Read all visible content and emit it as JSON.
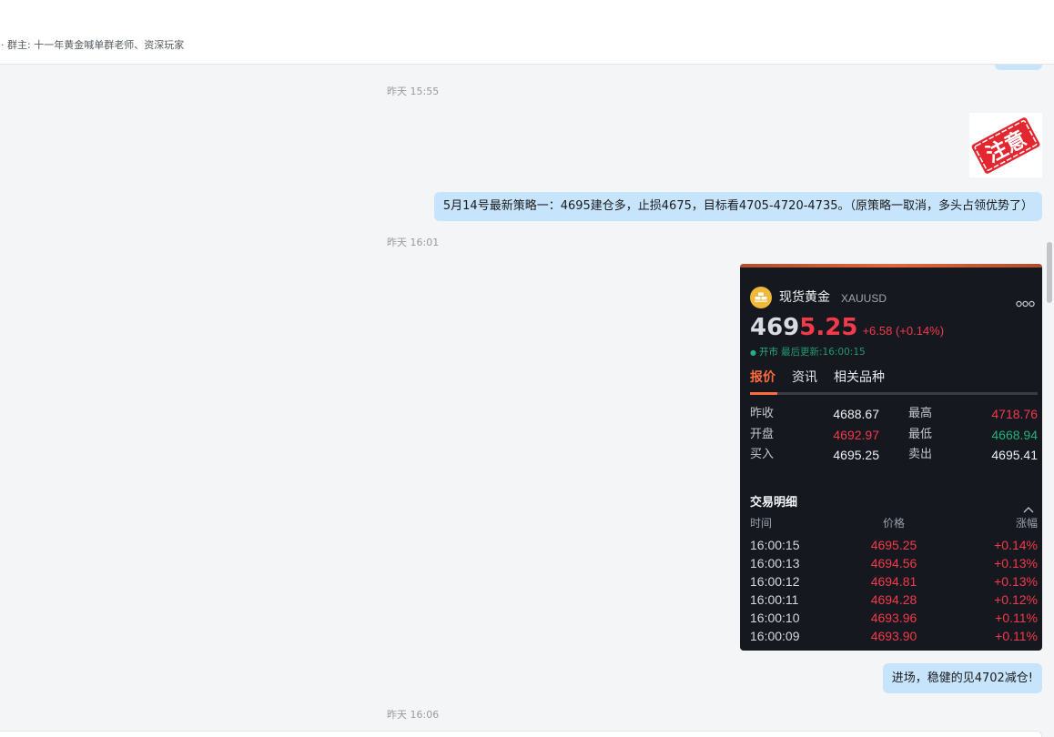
{
  "header": {
    "owner_line": "· 群主: 十一年黄金喊单群老师、资深玩家"
  },
  "timestamps": {
    "t1": "昨天 15:55",
    "t2": "昨天 16:01",
    "t3": "昨天 16:06"
  },
  "messages": {
    "stamp": {
      "icon": "warning-stamp-image",
      "text": "注意"
    },
    "strategy": "5月14号最新策略一：4695建仓多，止损4675，目标看4705-4720-4735。（原策略一取消，多头占领优势了）",
    "entry": "进场，稳健的见4702减仓!"
  },
  "quote_card": {
    "icon": "gold-bars-icon",
    "name": "现货黄金",
    "symbol": "XAUUSD",
    "more_icon": "more-dots-icon",
    "price": {
      "lead": "469",
      "tail": "5.25"
    },
    "change": "+6.58 (+0.14%)",
    "status_icon": "status-dot-icon",
    "status": "开市",
    "updated": "最后更新:16:00:15",
    "tabs": [
      "报价",
      "资讯",
      "相关品种"
    ],
    "active_tab": "报价",
    "stats": [
      {
        "label": "昨收",
        "value": "4688.67",
        "color": "#eef0f3"
      },
      {
        "label": "最高",
        "value": "4718.76",
        "color": "#f33a4b"
      },
      {
        "label": "开盘",
        "value": "4692.97",
        "color": "#f33a4b"
      },
      {
        "label": "最低",
        "value": "4668.94",
        "color": "#22b37b"
      },
      {
        "label": "买入",
        "value": "4695.25",
        "color": "#eef0f3"
      },
      {
        "label": "卖出",
        "value": "4695.41",
        "color": "#eef0f3"
      }
    ],
    "trades_title": "交易明细",
    "collapse_icon": "chevron-up-icon",
    "trade_columns": [
      "时间",
      "价格",
      "涨幅"
    ],
    "trades_color": "#f33a4b",
    "trades": [
      {
        "time": "16:00:15",
        "price": "4695.25",
        "change": "+0.14%"
      },
      {
        "time": "16:00:13",
        "price": "4694.56",
        "change": "+0.13%"
      },
      {
        "time": "16:00:12",
        "price": "4694.81",
        "change": "+0.13%"
      },
      {
        "time": "16:00:11",
        "price": "4694.28",
        "change": "+0.12%"
      },
      {
        "time": "16:00:10",
        "price": "4693.96",
        "change": "+0.11%"
      },
      {
        "time": "16:00:09",
        "price": "4693.90",
        "change": "+0.11%"
      }
    ]
  },
  "colors": {
    "chat_background": "#f4f5f7",
    "bubble": "#c6e4fc",
    "card_background": "#15181f",
    "up": "#f33a4b",
    "down": "#22b37b",
    "status": "#26b07f",
    "accent_orange": "#ff6b3a",
    "gold": "#f0b83a"
  }
}
